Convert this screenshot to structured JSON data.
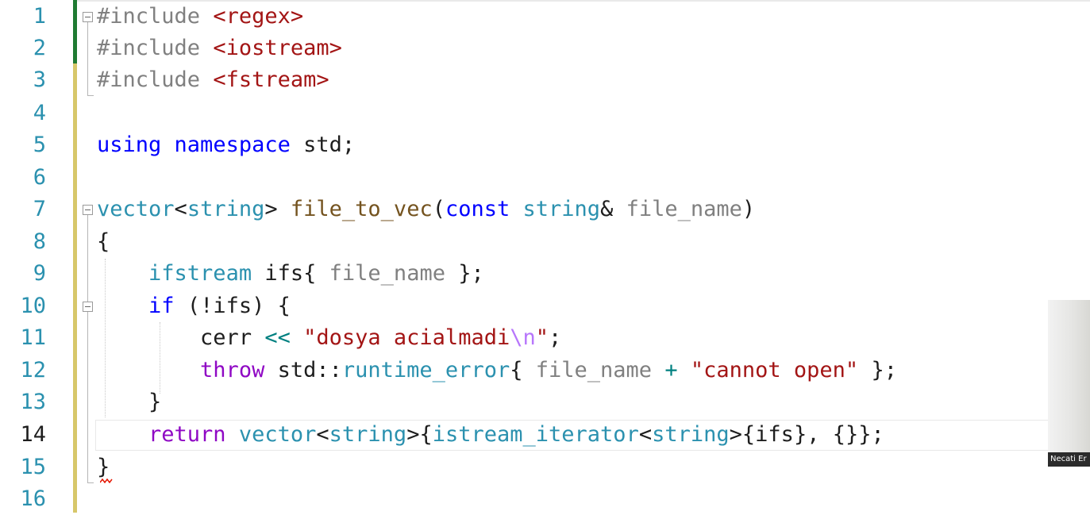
{
  "editor": {
    "current_line": 14,
    "line_numbers": [
      "1",
      "2",
      "3",
      "4",
      "5",
      "6",
      "7",
      "8",
      "9",
      "10",
      "11",
      "12",
      "13",
      "14",
      "15",
      "16"
    ]
  },
  "code": {
    "l1": {
      "pp": "#include",
      "inc": "<regex>"
    },
    "l2": {
      "pp": "#include",
      "inc": "<iostream>"
    },
    "l3": {
      "pp": "#include",
      "inc": "<fstream>"
    },
    "l5": {
      "kw1": "using",
      "kw2": "namespace",
      "ns": "std",
      "semi": ";"
    },
    "l7": {
      "t1": "vector",
      "lt": "<",
      "t2": "string",
      "gt": ">",
      "fn": "file_to_vec",
      "po": "(",
      "kw": "const",
      "t3": "string",
      "amp": "&",
      "prm": "file_name",
      "pc": ")"
    },
    "l8": {
      "brace": "{"
    },
    "l9": {
      "ty": "ifstream",
      "var": "ifs",
      "o": "{",
      "prm": "file_name",
      "c": "};"
    },
    "l10": {
      "kw": "if",
      "rest": "(!ifs) {"
    },
    "l11": {
      "id": "cerr",
      "op": "<<",
      "str_a": "\"dosya acialmadi",
      "esc": "\\n",
      "str_b": "\"",
      "semi": ";"
    },
    "l12": {
      "kw": "throw",
      "ns": "std",
      "sep": "::",
      "ty": "runtime_error",
      "o": "{",
      "prm": "file_name",
      "op": "+",
      "str": "\"cannot open\"",
      "c": "};"
    },
    "l13": {
      "brace": "}"
    },
    "l14": {
      "kw": "return",
      "t1": "vector",
      "lt1": "<",
      "t2": "string",
      "gt1": ">",
      "o1": "{",
      "t3": "istream_iterator",
      "lt2": "<",
      "t4": "string",
      "gt2": ">",
      "o2": "{",
      "var": "ifs",
      "rest": "}, {}};"
    },
    "l15": {
      "brace": "}"
    }
  },
  "webcam": {
    "name_label": "Necati Er"
  },
  "colors": {
    "keyword": "#0000ff",
    "type": "#2b91af",
    "preprocessor": "#808080",
    "include_path": "#a31515",
    "string": "#a31515",
    "escape": "#b776fb",
    "function": "#74531f",
    "parameter": "#808080",
    "control": "#8f08c4",
    "operator": "#008080",
    "line_number": "#2b91af",
    "saved_change": "#1f7a32",
    "unsaved_change": "#d7c76a"
  }
}
